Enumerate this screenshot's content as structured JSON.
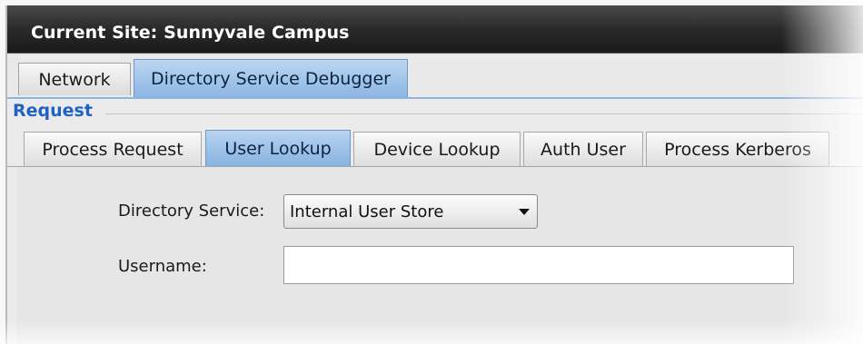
{
  "window": {
    "title": "Current Site:  Sunnyvale Campus"
  },
  "top_tabs": [
    {
      "label": "Network",
      "active": false
    },
    {
      "label": "Directory Service Debugger",
      "active": true
    }
  ],
  "request": {
    "legend": "Request",
    "sub_tabs": [
      {
        "label": "Process Request",
        "active": false
      },
      {
        "label": "User Lookup",
        "active": true
      },
      {
        "label": "Device Lookup",
        "active": false
      },
      {
        "label": "Auth User",
        "active": false
      },
      {
        "label": "Process Kerberos",
        "active": false
      }
    ]
  },
  "form": {
    "directory_service_label": "Directory Service:",
    "directory_service_value": "Internal User Store",
    "username_label": "Username:",
    "username_value": ""
  },
  "colors": {
    "accent_blue": "#1e62c4",
    "active_tab": "#8cb6e3",
    "title_bar": "#2a2a2a"
  }
}
